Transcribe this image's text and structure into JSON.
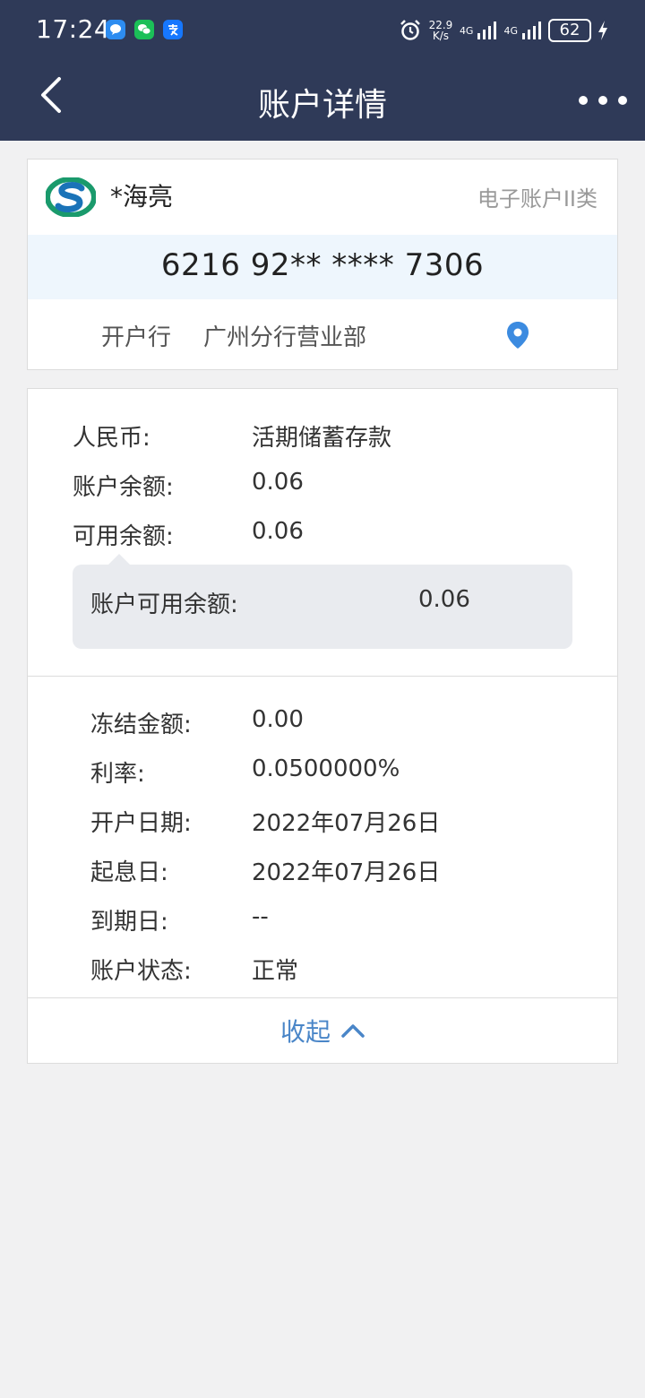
{
  "status_bar": {
    "time": "17:24",
    "net_speed_value": "22.9",
    "net_speed_unit": "K/s",
    "signal1_label": "4G",
    "signal2_label": "4G",
    "battery": "62"
  },
  "nav": {
    "title": "账户详情"
  },
  "account": {
    "owner_name": "*海亮",
    "account_type": "电子账户II类",
    "number": "6216 92** **** 7306",
    "branch_label": "开户行",
    "branch_value": "广州分行营业部"
  },
  "details": {
    "currency_label": "人民币:",
    "currency_value": "活期储蓄存款",
    "balance_label": "账户余额:",
    "balance_value": "0.06",
    "available_label": "可用余额:",
    "available_value": "0.06",
    "tooltip_label": "账户可用余额:",
    "tooltip_value": "0.06",
    "frozen_label": "冻结金额:",
    "frozen_value": "0.00",
    "rate_label": "利率:",
    "rate_value": "0.0500000%",
    "open_date_label": "开户日期:",
    "open_date_value": "2022年07月26日",
    "interest_start_label": "起息日:",
    "interest_start_value": "2022年07月26日",
    "maturity_label": "到期日:",
    "maturity_value": "--",
    "status_label": "账户状态:",
    "status_value": "正常"
  },
  "collapse_label": "收起",
  "colors": {
    "header_bg": "#2f3a58",
    "accent": "#4a86c8",
    "highlight_band": "#eef6fd"
  }
}
